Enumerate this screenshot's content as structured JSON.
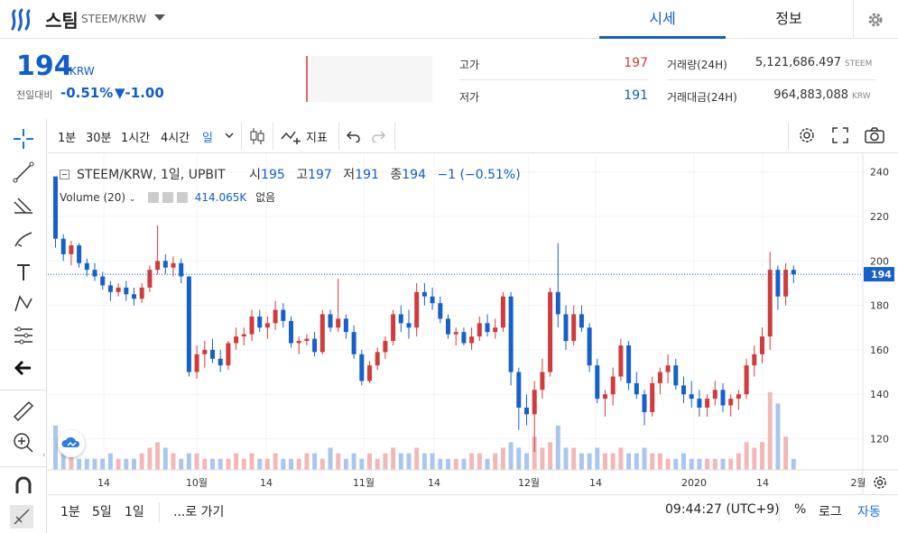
{
  "header": {
    "coin_name": "스팀",
    "pair": "STEEM/KRW",
    "tabs": [
      "시세",
      "정보"
    ]
  },
  "price": {
    "current": "194",
    "unit": "KRW",
    "change_label": "전일대비",
    "change_pct": "-0.51%",
    "change_abs": "▼-1.00"
  },
  "stats": {
    "high_label": "고가",
    "high": "197",
    "low_label": "저가",
    "low": "191",
    "volume_label": "거래량(24H)",
    "volume": "5,121,686.497",
    "volume_unit": "STEEM",
    "value_label": "거래대금(24H)",
    "value": "964,883,088",
    "value_unit": "KRW"
  },
  "toolbar": {
    "intervals": [
      "1분",
      "30분",
      "1시간",
      "4시간",
      "일"
    ],
    "indicators_label": "지표"
  },
  "legend": {
    "symbol": "STEEM/KRW, 1일, UPBIT",
    "open_label": "시",
    "open": "195",
    "high_label": "고",
    "high": "197",
    "low_label": "저",
    "low": "191",
    "close_label": "종",
    "close": "194",
    "change": "−1 (−0.51%)",
    "volume_title": "Volume (20)",
    "volume_value": "414.065K",
    "volume_extra": "없음"
  },
  "bottom": {
    "ranges": [
      "1분",
      "5일",
      "1일"
    ],
    "goto": "...로 가기",
    "time": "09:44:27 (UTC+9)",
    "pct": "%",
    "log": "로그",
    "auto": "자동"
  },
  "colors": {
    "accent": "#115dcb",
    "up": "#d03b3b",
    "down": "#1561c9"
  },
  "chart_data": {
    "type": "candlestick",
    "title": "STEEM/KRW, 1일, UPBIT",
    "price_axis_ticks": [
      120,
      140,
      160,
      180,
      200,
      220,
      240
    ],
    "ylim": [
      106,
      248
    ],
    "time_axis_labels": [
      "14",
      "10월",
      "14",
      "11월",
      "14",
      "12월",
      "14",
      "2020",
      "14",
      "2월"
    ],
    "last_price_label": "194",
    "series": [
      {
        "name": "price",
        "ohlc": [
          [
            238,
            212,
            206,
            210
          ],
          [
            210,
            212,
            200,
            203
          ],
          [
            203,
            209,
            198,
            207
          ],
          [
            207,
            208,
            197,
            199
          ],
          [
            199,
            201,
            193,
            196
          ],
          [
            196,
            199,
            191,
            193
          ],
          [
            193,
            195,
            187,
            189
          ],
          [
            189,
            191,
            182,
            186
          ],
          [
            186,
            190,
            184,
            188
          ],
          [
            188,
            191,
            182,
            185
          ],
          [
            185,
            188,
            180,
            183
          ],
          [
            183,
            190,
            181,
            188
          ],
          [
            188,
            198,
            186,
            196
          ],
          [
            196,
            216,
            194,
            200
          ],
          [
            200,
            203,
            194,
            197
          ],
          [
            197,
            202,
            193,
            199
          ],
          [
            199,
            201,
            190,
            193
          ],
          [
            193,
            188,
            148,
            150
          ],
          [
            150,
            162,
            147,
            158
          ],
          [
            158,
            164,
            152,
            160
          ],
          [
            160,
            165,
            154,
            156
          ],
          [
            156,
            160,
            150,
            153
          ],
          [
            153,
            164,
            151,
            163
          ],
          [
            163,
            170,
            160,
            166
          ],
          [
            166,
            170,
            162,
            167
          ],
          [
            167,
            178,
            164,
            175
          ],
          [
            175,
            178,
            168,
            170
          ],
          [
            170,
            175,
            165,
            172
          ],
          [
            172,
            182,
            169,
            178
          ],
          [
            178,
            181,
            170,
            173
          ],
          [
            173,
            175,
            161,
            163
          ],
          [
            163,
            166,
            158,
            164
          ],
          [
            164,
            167,
            162,
            165
          ],
          [
            165,
            168,
            157,
            159
          ],
          [
            159,
            178,
            158,
            176
          ],
          [
            176,
            178,
            168,
            170
          ],
          [
            170,
            192,
            168,
            174
          ],
          [
            174,
            176,
            165,
            168
          ],
          [
            168,
            171,
            156,
            158
          ],
          [
            158,
            160,
            144,
            146
          ],
          [
            146,
            155,
            145,
            153
          ],
          [
            153,
            161,
            151,
            159
          ],
          [
            159,
            166,
            156,
            164
          ],
          [
            164,
            178,
            162,
            176
          ],
          [
            176,
            180,
            168,
            172
          ],
          [
            172,
            178,
            165,
            170
          ],
          [
            170,
            190,
            166,
            186
          ],
          [
            186,
            190,
            180,
            184
          ],
          [
            184,
            188,
            178,
            181
          ],
          [
            181,
            184,
            172,
            174
          ],
          [
            174,
            176,
            165,
            167
          ],
          [
            167,
            170,
            162,
            168
          ],
          [
            168,
            170,
            162,
            163
          ],
          [
            163,
            170,
            160,
            166
          ],
          [
            166,
            175,
            164,
            172
          ],
          [
            172,
            176,
            166,
            168
          ],
          [
            168,
            174,
            165,
            170
          ],
          [
            170,
            186,
            168,
            184
          ],
          [
            184,
            186,
            144,
            150
          ],
          [
            150,
            152,
            124,
            134
          ],
          [
            134,
            140,
            126,
            131
          ],
          [
            131,
            146,
            114,
            142
          ],
          [
            142,
            156,
            138,
            150
          ],
          [
            150,
            188,
            148,
            186
          ],
          [
            186,
            208,
            170,
            176
          ],
          [
            176,
            180,
            160,
            164
          ],
          [
            164,
            180,
            162,
            176
          ],
          [
            176,
            180,
            168,
            170
          ],
          [
            170,
            172,
            150,
            153
          ],
          [
            153,
            156,
            136,
            138
          ],
          [
            138,
            142,
            130,
            140
          ],
          [
            140,
            152,
            135,
            148
          ],
          [
            148,
            165,
            146,
            162
          ],
          [
            162,
            164,
            142,
            145
          ],
          [
            145,
            150,
            138,
            140
          ],
          [
            140,
            142,
            126,
            132
          ],
          [
            132,
            148,
            130,
            145
          ],
          [
            145,
            152,
            140,
            150
          ],
          [
            150,
            158,
            145,
            153
          ],
          [
            153,
            156,
            142,
            144
          ],
          [
            144,
            148,
            136,
            140
          ],
          [
            140,
            146,
            134,
            138
          ],
          [
            138,
            142,
            130,
            134
          ],
          [
            134,
            140,
            130,
            138
          ],
          [
            138,
            146,
            135,
            142
          ],
          [
            142,
            145,
            132,
            135
          ],
          [
            135,
            140,
            130,
            138
          ],
          [
            138,
            142,
            133,
            140
          ],
          [
            140,
            156,
            138,
            153
          ],
          [
            153,
            162,
            148,
            158
          ],
          [
            158,
            170,
            154,
            166
          ],
          [
            166,
            204,
            160,
            196
          ],
          [
            196,
            198,
            178,
            184
          ],
          [
            184,
            199,
            180,
            196
          ],
          [
            196,
            198,
            190,
            194
          ]
        ]
      },
      {
        "name": "Volume (20)",
        "values": [
          8,
          4,
          3,
          2,
          2,
          2,
          2,
          3,
          2,
          2,
          2,
          3,
          4,
          5,
          4,
          3,
          2,
          3,
          3,
          2,
          2,
          2,
          2,
          3,
          2,
          3,
          2,
          2,
          3,
          2,
          2,
          2,
          3,
          3,
          2,
          4,
          3,
          2,
          3,
          2,
          3,
          2,
          3,
          4,
          3,
          3,
          4,
          3,
          3,
          2,
          2,
          2,
          2,
          3,
          3,
          2,
          3,
          4,
          5,
          4,
          3,
          6,
          4,
          5,
          8,
          4,
          4,
          3,
          3,
          4,
          3,
          3,
          4,
          3,
          3,
          4,
          3,
          3,
          2,
          2,
          3,
          2,
          2,
          2,
          2,
          2,
          2,
          3,
          5,
          4,
          5,
          14,
          12,
          6,
          2
        ]
      }
    ]
  }
}
